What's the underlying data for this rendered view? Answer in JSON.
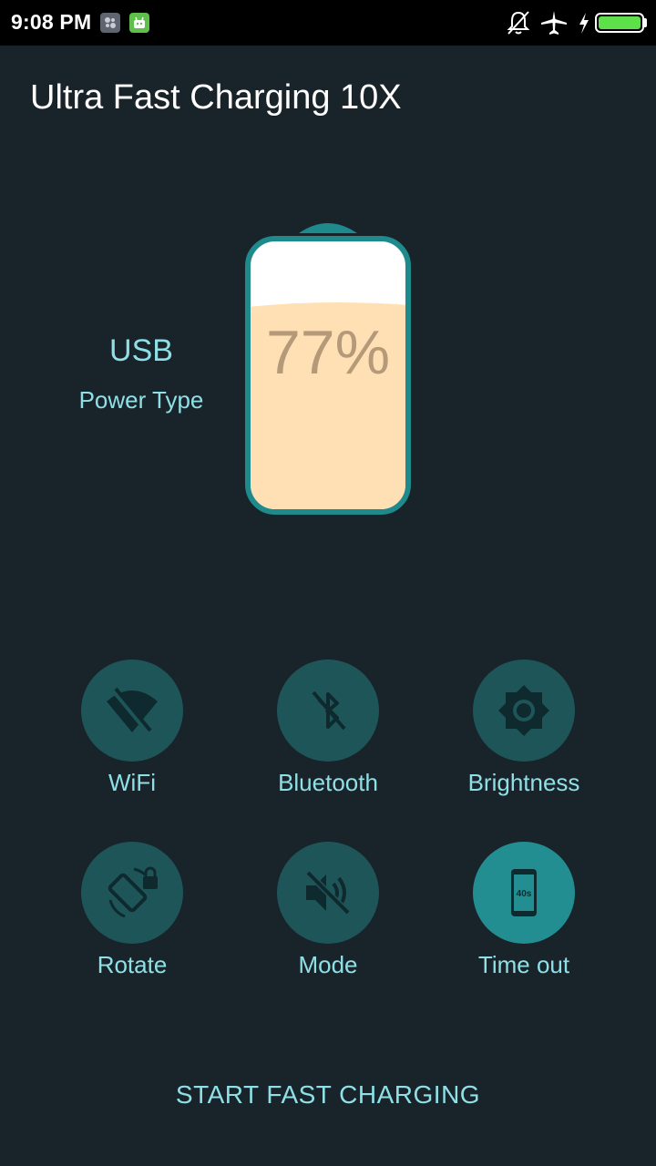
{
  "status_bar": {
    "time": "9:08 PM",
    "icons": [
      "app-notification-icon",
      "android-notification-icon",
      "bell-off-icon",
      "airplane-icon",
      "charging-bolt-icon",
      "battery-icon"
    ]
  },
  "app": {
    "title": "Ultra Fast Charging 10X"
  },
  "power": {
    "type_value": "USB",
    "type_label": "Power Type"
  },
  "battery": {
    "percent_text": "77%",
    "level_fraction": 0.77
  },
  "toggles": [
    {
      "label": "WiFi",
      "icon": "wifi-off-icon",
      "active": false
    },
    {
      "label": "Bluetooth",
      "icon": "bluetooth-off-icon",
      "active": false
    },
    {
      "label": "Brightness",
      "icon": "brightness-icon",
      "active": false
    },
    {
      "label": "Rotate",
      "icon": "rotate-lock-icon",
      "active": false
    },
    {
      "label": "Mode",
      "icon": "volume-off-icon",
      "active": false
    },
    {
      "label": "Time out",
      "icon": "screen-timeout-icon",
      "active": true,
      "badge": "40s"
    }
  ],
  "action": {
    "start_label": "START FAST CHARGING"
  },
  "colors": {
    "background": "#19232a",
    "accent_text": "#8fe0e6",
    "toggle_inactive": "#1e5559",
    "toggle_active": "#228e91",
    "battery_border": "#1f8a8c",
    "battery_fill": "#ffe0b4",
    "battery_percent_text": "#b49a78"
  }
}
